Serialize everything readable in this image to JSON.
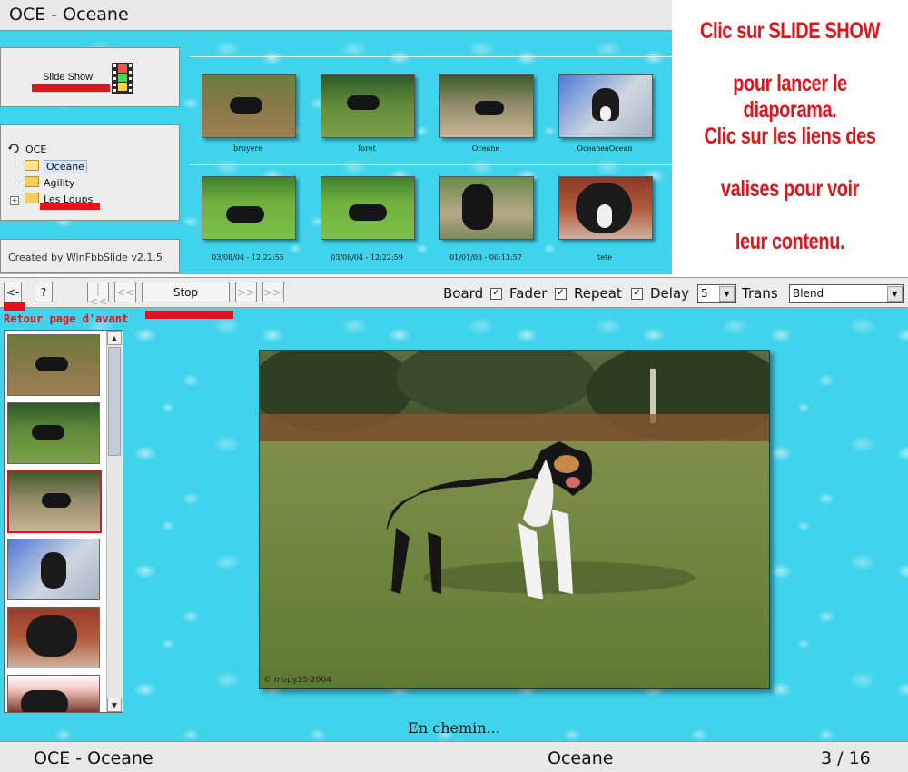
{
  "window": {
    "title": "OCE - Oceane"
  },
  "sidebar": {
    "slideshow_label": "Slide Show",
    "tree": [
      {
        "label": "OCE",
        "icon": "refresh-icon"
      },
      {
        "label": "Oceane",
        "icon": "open-folder-icon",
        "selected": true
      },
      {
        "label": "Agility",
        "icon": "folder-icon"
      },
      {
        "label": "Les Loups",
        "icon": "folder-icon",
        "expandable": true
      }
    ],
    "version": "Created by  WinFbbSlide  v2.1.5"
  },
  "gallery": {
    "row1": [
      {
        "label": "bruyere"
      },
      {
        "label": "foret"
      },
      {
        "label": "Oceane"
      },
      {
        "label": "OceaneaOcean"
      }
    ],
    "row2": [
      {
        "label": "03/08/04 - 12:22:55"
      },
      {
        "label": "03/08/04 - 12:22:59"
      },
      {
        "label": "01/01/03 - 00:13:57"
      },
      {
        "label": "tete"
      }
    ]
  },
  "instructions": [
    "Clic sur SLIDE SHOW",
    "pour lancer le diaporama.",
    "Clic sur les liens des",
    "valises pour voir",
    "leur contenu."
  ],
  "toolbar": {
    "back": "<-",
    "help": "?",
    "first": "|<<",
    "prev": "<<",
    "stop": "Stop",
    "next": ">>",
    "last": ">>|",
    "board": "Board",
    "fader": "Fader",
    "repeat": "Repeat",
    "delay_label": "Delay",
    "delay_value": "5",
    "trans_label": "Trans",
    "trans_value": "Blend",
    "check_mark": "✓"
  },
  "back_hint": "Retour page d'avant",
  "photo": {
    "caption": "En chemin...",
    "watermark": "© mopy33-2004"
  },
  "status": {
    "album": "OCE - Oceane",
    "current": "Oceane",
    "counter": "3 / 16"
  },
  "colors": {
    "accent_red": "#e0141c",
    "water": "#3fd3ec"
  }
}
